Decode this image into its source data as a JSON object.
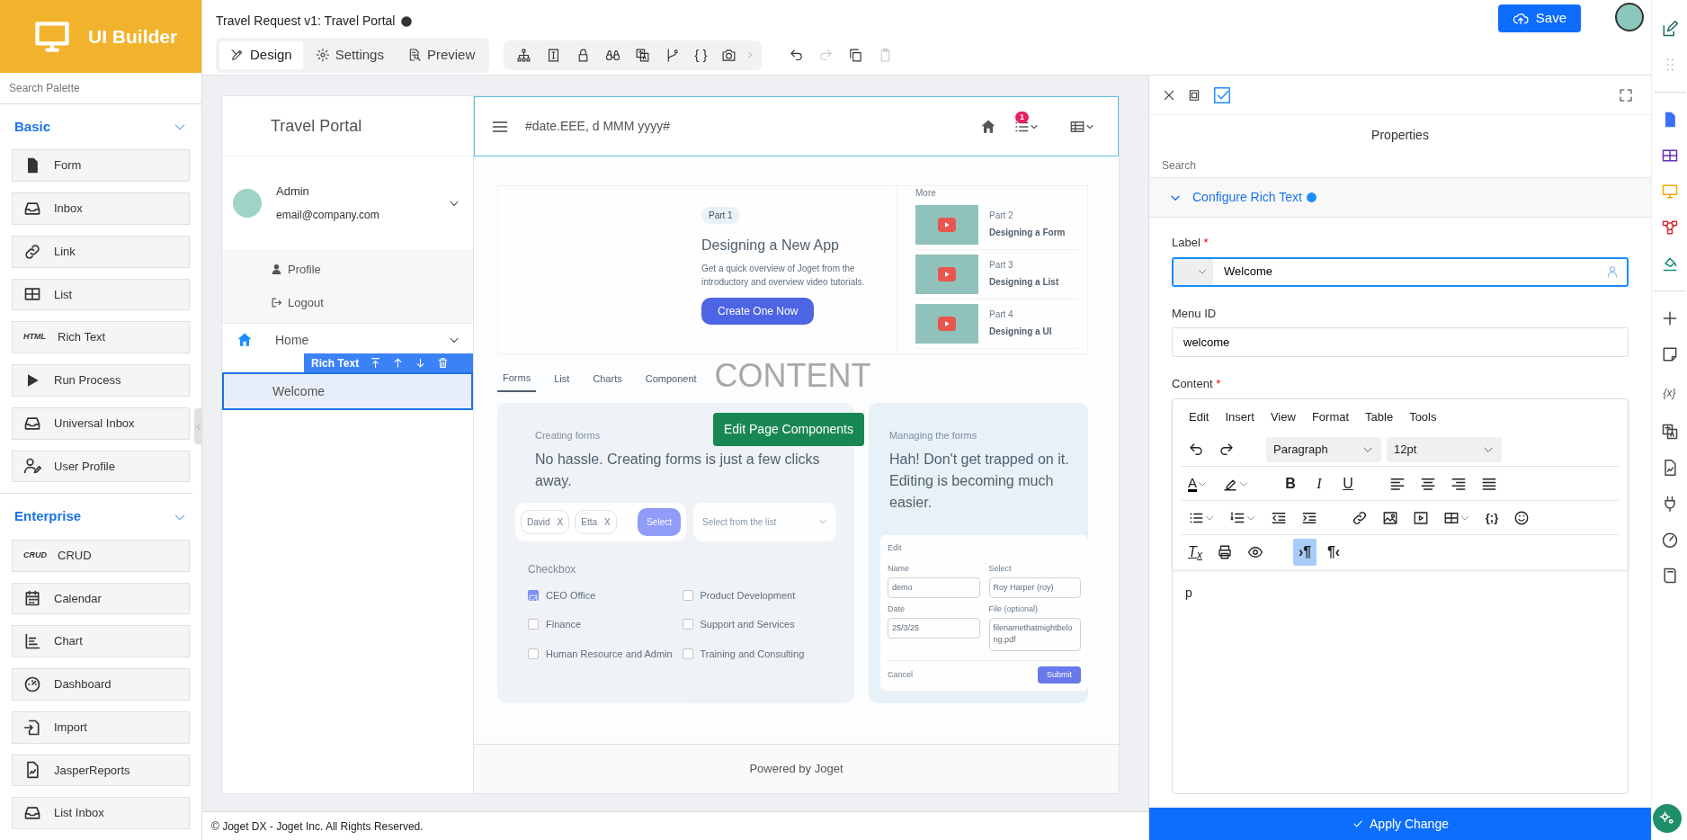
{
  "brand": {
    "title": "UI Builder"
  },
  "palette": {
    "search_placeholder": "Search Palette",
    "groups": [
      {
        "title": "Basic",
        "expanded": true,
        "items": [
          {
            "label": "Form",
            "kind": "form"
          },
          {
            "label": "Inbox",
            "kind": "inbox"
          },
          {
            "label": "Link",
            "kind": "link"
          },
          {
            "label": "List",
            "kind": "list"
          },
          {
            "label": "Rich Text",
            "kind": "tag",
            "tag": "HTML"
          },
          {
            "label": "Run Process",
            "kind": "play"
          },
          {
            "label": "Universal Inbox",
            "kind": "inbox"
          },
          {
            "label": "User Profile",
            "kind": "user"
          }
        ]
      },
      {
        "title": "Enterprise",
        "expanded": true,
        "items": [
          {
            "label": "CRUD",
            "kind": "tag",
            "tag": "CRUD"
          },
          {
            "label": "Calendar",
            "kind": "calendar"
          },
          {
            "label": "Chart",
            "kind": "chart"
          },
          {
            "label": "Dashboard",
            "kind": "dashboard"
          },
          {
            "label": "Import",
            "kind": "import"
          },
          {
            "label": "JasperReports",
            "kind": "report"
          },
          {
            "label": "List Inbox",
            "kind": "inbox"
          }
        ]
      }
    ]
  },
  "topbar": {
    "title": "Travel Request v1: Travel Portal",
    "tabs": [
      {
        "label": "Design",
        "kind": "design",
        "selected": true
      },
      {
        "label": "Settings",
        "kind": "settings",
        "selected": false
      },
      {
        "label": "Preview",
        "kind": "preview",
        "selected": false
      }
    ],
    "code_glyph": "{ }",
    "history": [
      {
        "kind": "undo",
        "disabled": false
      },
      {
        "kind": "redo",
        "disabled": true
      },
      {
        "kind": "copy",
        "disabled": false
      },
      {
        "kind": "paste",
        "disabled": true
      }
    ],
    "save": "Save"
  },
  "portal": {
    "title": "Travel Portal",
    "user": {
      "name": "Admin",
      "email": "email@company.com",
      "expanded": true
    },
    "user_menu": [
      {
        "label": "Profile",
        "kind": "profile"
      },
      {
        "label": "Logout",
        "kind": "logout"
      }
    ],
    "menu": [
      {
        "label": "Home",
        "kind": "category",
        "selected": false
      },
      {
        "label": "Welcome",
        "kind": "page",
        "selected": true
      }
    ],
    "selection_label": "Rich Text",
    "date": "#date.EEE, d MMM yyyy#",
    "notification_count": "1",
    "hero": {
      "tag": "Part 1",
      "title": "Designing a New App",
      "text": "Get a quick overview of Joget from the introductory and overview video tutorials.",
      "button": "Create One Now"
    },
    "more": {
      "title": "More",
      "items": [
        {
          "part": "Part 2",
          "title": "Designing a Form"
        },
        {
          "part": "Part 3",
          "title": "Designing a List"
        },
        {
          "part": "Part 4",
          "title": "Designing a UI"
        }
      ]
    },
    "tabs": [
      {
        "label": "Forms",
        "selected": true
      },
      {
        "label": "List",
        "selected": false
      },
      {
        "label": "Charts",
        "selected": false
      },
      {
        "label": "Component",
        "selected": false
      }
    ],
    "watermark": "CONTENT",
    "edit_button": "Edit Page Components",
    "card_forms": {
      "eyebrow": "Creating forms",
      "heading": "No hassle. Creating forms is just a few clicks away.",
      "chips": [
        {
          "label": "David",
          "remove": "X"
        },
        {
          "label": "Etta",
          "remove": "X"
        }
      ],
      "select_button": "Select",
      "dropdown_placeholder": "Select from the list",
      "checkbox_title": "Checkbox",
      "options": [
        {
          "label": "CEO Office",
          "checked": true
        },
        {
          "label": "Product Development",
          "checked": false
        },
        {
          "label": "Finance",
          "checked": false
        },
        {
          "label": "Support and Services",
          "checked": false
        },
        {
          "label": "Human Resource and Admin",
          "checked": false
        },
        {
          "label": "Training and Consulting",
          "checked": false
        }
      ]
    },
    "card_manage": {
      "eyebrow": "Managing the forms",
      "heading": "Hah! Don't get trapped on it. Editing is becoming much easier.",
      "mini_form": {
        "title": "Edit",
        "fields": [
          {
            "label": "Name",
            "value": "demo"
          },
          {
            "label": "Select",
            "value": "Roy Harper (roy)"
          },
          {
            "label": "Date",
            "value": "25/3/25"
          },
          {
            "label": "File (optional)",
            "value": "filenamethatmightbelong.pdf"
          }
        ],
        "cancel": "Cancel",
        "submit": "Submit"
      }
    },
    "footer": "Powered by Joget"
  },
  "copyright": "© Joget DX - Joget Inc. All Rights Reserved.",
  "properties": {
    "title": "Properties",
    "search_placeholder": "Search",
    "section": {
      "title": "Configure Rich Text",
      "expanded": true
    },
    "fields": [
      {
        "label": "Label",
        "required": true,
        "value": "Welcome",
        "kind": "translatable",
        "focused": true
      },
      {
        "label": "Menu ID",
        "required": false,
        "value": "welcome",
        "kind": "text",
        "focused": false
      }
    ],
    "content_label": "Content",
    "content_required": true,
    "required_mark": "*",
    "editor": {
      "menus": [
        "Edit",
        "Insert",
        "View",
        "Format",
        "Table",
        "Tools"
      ],
      "block_format": "Paragraph",
      "font_size": "12pt",
      "text_color_glyph": "A",
      "format_glyphs": [
        "B",
        "I",
        "U"
      ],
      "code_glyph": "{;}",
      "clear_glyph": "T$_{x}$",
      "direction": [
        {
          "glyph": "›¶",
          "selected": true
        },
        {
          "glyph": "¶‹",
          "selected": false
        }
      ],
      "content": "p"
    },
    "apply": "Apply Change"
  },
  "side_glyph": "{x}"
}
